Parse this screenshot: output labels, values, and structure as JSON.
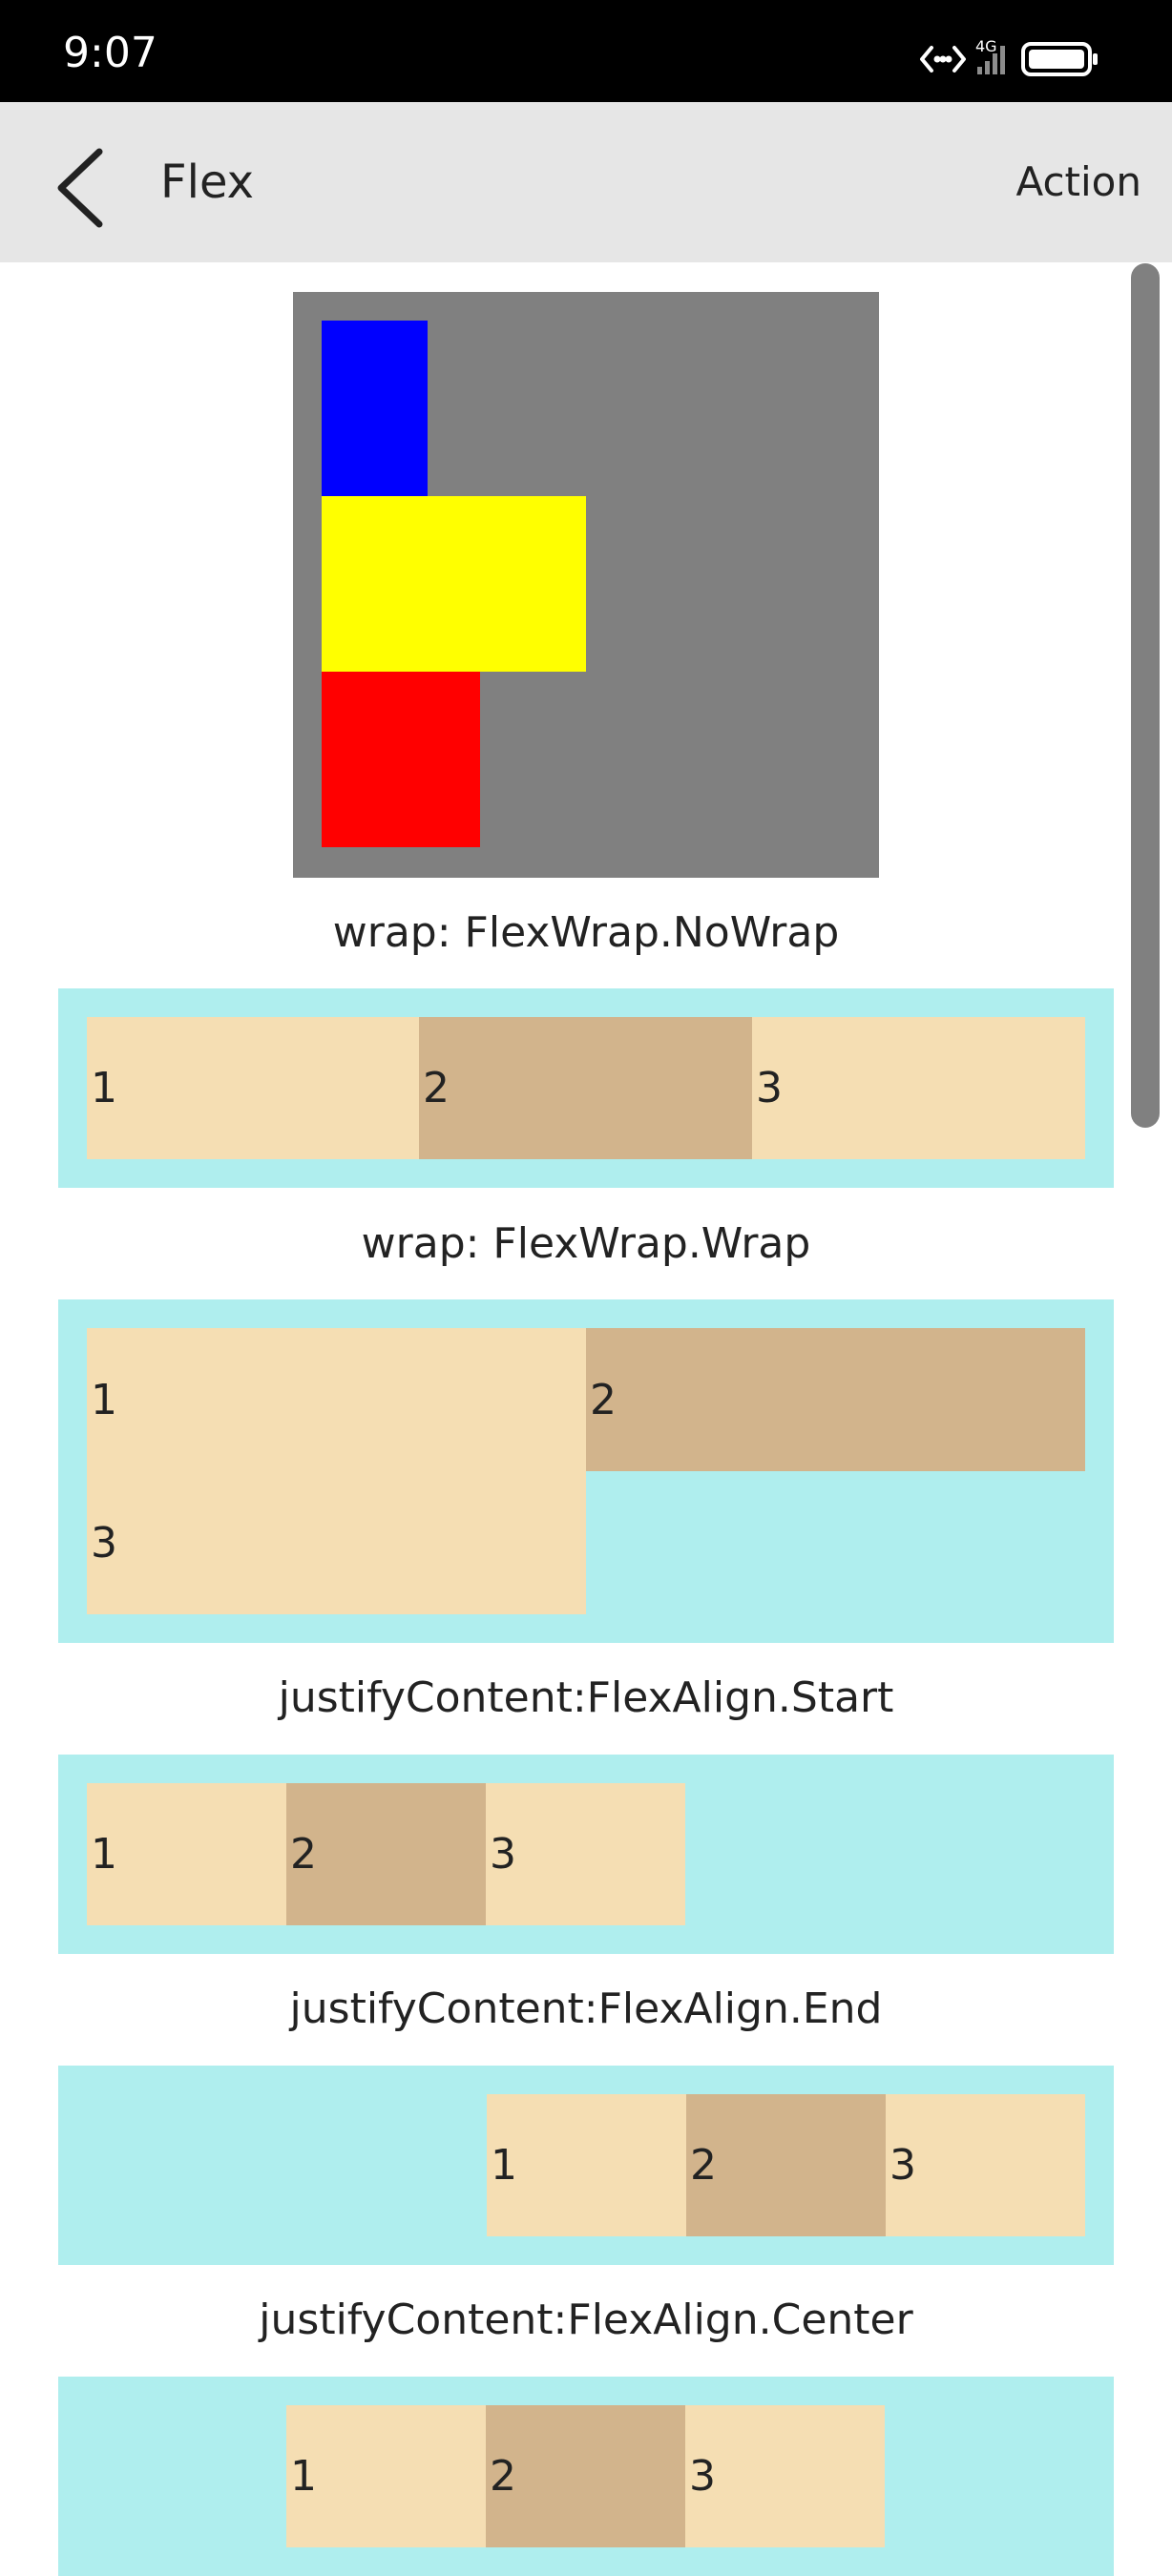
{
  "status_bar": {
    "time": "9:07",
    "network_label": "4G"
  },
  "title_bar": {
    "title": "Flex",
    "action_label": "Action"
  },
  "colors": {
    "gray_box": "#808080",
    "blue": "#0000ff",
    "yellow": "#ffff00",
    "red": "#ff0000",
    "cyan": "#afeeee",
    "wheat": "#f5deb3",
    "tan": "#d2b48c",
    "title_bar": "#e6e6e6"
  },
  "demo_square": {
    "items": [
      {
        "name": "blue-block",
        "color": "blue"
      },
      {
        "name": "yellow-block",
        "color": "yellow"
      },
      {
        "name": "red-block",
        "color": "red"
      }
    ]
  },
  "sections": [
    {
      "caption": "wrap: FlexWrap.NoWrap",
      "items": [
        "1",
        "2",
        "3"
      ]
    },
    {
      "caption": "wrap: FlexWrap.Wrap",
      "items": [
        "1",
        "2",
        "3"
      ]
    },
    {
      "caption": "justifyContent:FlexAlign.Start",
      "items": [
        "1",
        "2",
        "3"
      ]
    },
    {
      "caption": "justifyContent:FlexAlign.End",
      "items": [
        "1",
        "2",
        "3"
      ]
    },
    {
      "caption": "justifyContent:FlexAlign.Center",
      "items": [
        "1",
        "2",
        "3"
      ]
    }
  ]
}
